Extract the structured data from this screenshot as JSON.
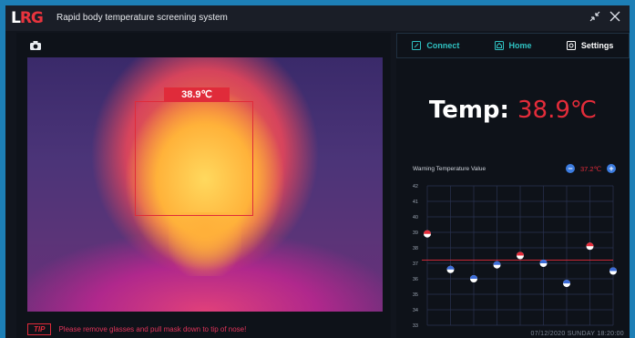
{
  "window": {
    "logo": {
      "part1": "L",
      "part2": "RG"
    },
    "title": "Rapid body temperature screening system",
    "buttons": {
      "compress_icon": "compress-icon",
      "close_icon": "close-icon"
    }
  },
  "camera": {
    "icon": "camera-icon",
    "face_label": "38.9℃"
  },
  "tip": {
    "badge": "TIP",
    "text": "Please remove glasses and pull mask down to tip of nose!"
  },
  "nav": {
    "connect": "Connect",
    "home": "Home",
    "settings": "Settings"
  },
  "temperature": {
    "label": "Temp: ",
    "value": "38.9℃"
  },
  "warning": {
    "label": "Warning Temperature Value",
    "minus": "−",
    "value": "37.2℃",
    "plus": "+"
  },
  "datetime": "07/12/2020  SUNDAY 18:20:00",
  "colors": {
    "accent_red": "#e42c3a",
    "accent_teal": "#2fc2c2",
    "plus_minus_blue": "#3c7ce0",
    "grid": "#2a3352"
  },
  "chart_data": {
    "type": "scatter",
    "y_ticks": [
      42,
      41,
      40,
      39,
      38,
      37,
      36,
      35,
      34,
      33
    ],
    "ylim": [
      33,
      42
    ],
    "threshold": 37.2,
    "values": [
      38.9,
      36.6,
      36.0,
      36.9,
      37.5,
      37.0,
      35.7,
      38.1,
      36.5
    ],
    "legend": "none",
    "grid": true
  }
}
